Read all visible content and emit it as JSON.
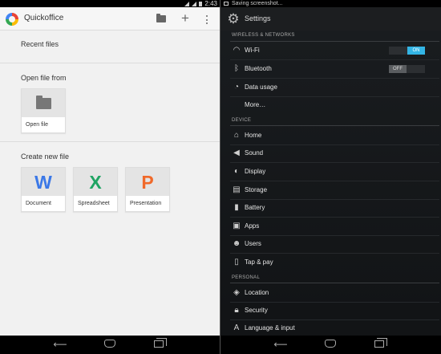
{
  "left": {
    "status_time": "2:43",
    "app_title": "Quickoffice",
    "recent_files_heading": "Recent files",
    "open_file_from_heading": "Open file from",
    "open_file_label": "Open file",
    "create_new_heading": "Create new file",
    "new_files": [
      {
        "glyph": "W",
        "label": "Document",
        "color": "#3b78e7"
      },
      {
        "glyph": "X",
        "label": "Spreadsheet",
        "color": "#1fa463"
      },
      {
        "glyph": "P",
        "label": "Presentation",
        "color": "#f0692a"
      }
    ]
  },
  "right": {
    "status_text": "Saving screenshot...",
    "title": "Settings",
    "sections": [
      {
        "heading": "WIRELESS & NETWORKS"
      },
      {
        "heading": "DEVICE"
      },
      {
        "heading": "PERSONAL"
      }
    ],
    "items": [
      {
        "label": "Wi-Fi",
        "icon": "wifi-icon",
        "toggle": "ON"
      },
      {
        "label": "Bluetooth",
        "icon": "bluetooth-icon",
        "toggle": "OFF"
      },
      {
        "label": "Data usage",
        "icon": "data-usage-icon"
      },
      {
        "label": "More…",
        "icon": ""
      },
      {
        "label": "Home",
        "icon": "home-icon"
      },
      {
        "label": "Sound",
        "icon": "sound-icon"
      },
      {
        "label": "Display",
        "icon": "display-icon"
      },
      {
        "label": "Storage",
        "icon": "storage-icon"
      },
      {
        "label": "Battery",
        "icon": "battery-icon"
      },
      {
        "label": "Apps",
        "icon": "apps-icon"
      },
      {
        "label": "Users",
        "icon": "users-icon"
      },
      {
        "label": "Tap & pay",
        "icon": "tap-pay-icon"
      },
      {
        "label": "Location",
        "icon": "location-icon"
      },
      {
        "label": "Security",
        "icon": "lock-icon"
      },
      {
        "label": "Language & input",
        "icon": "language-icon"
      }
    ]
  },
  "colors": {
    "accent": "#33b5e5",
    "left_bg": "#f1f1f1",
    "right_bg": "#15181a"
  }
}
